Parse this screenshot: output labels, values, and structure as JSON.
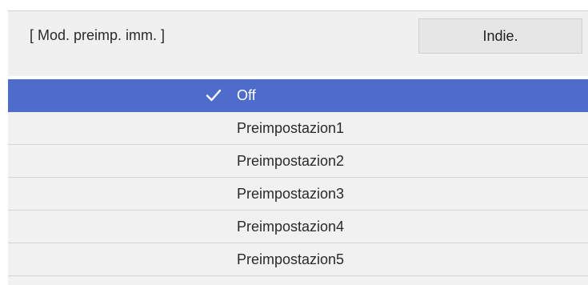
{
  "header": {
    "title": "[ Mod. preimp. imm. ]",
    "back_label": "Indie."
  },
  "list": {
    "selected_index": 0,
    "items": [
      {
        "label": "Off"
      },
      {
        "label": "Preimpostazion1"
      },
      {
        "label": "Preimpostazion2"
      },
      {
        "label": "Preimpostazion3"
      },
      {
        "label": "Preimpostazion4"
      },
      {
        "label": "Preimpostazion5"
      }
    ]
  },
  "colors": {
    "selected_row": "#4e6cc9",
    "row_background": "#f1f1f1",
    "header_background": "#f0f0f0"
  },
  "icons": {
    "selected_marker": "checkmark-icon"
  }
}
